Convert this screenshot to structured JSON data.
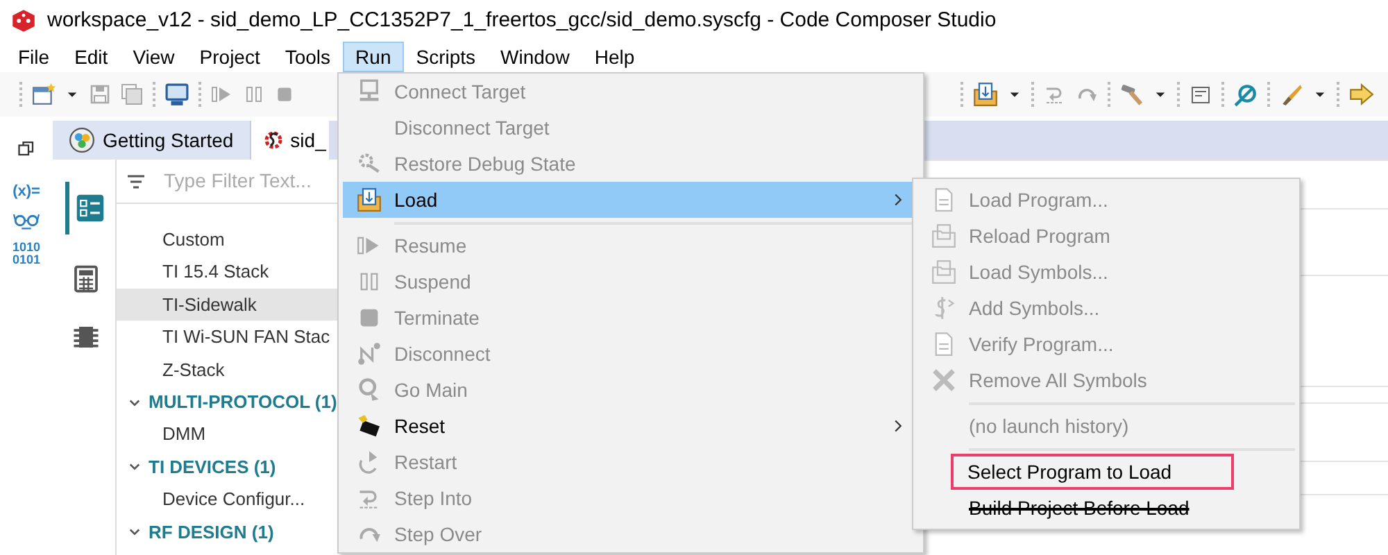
{
  "window": {
    "title": "workspace_v12 - sid_demo_LP_CC1352P7_1_freertos_gcc/sid_demo.syscfg - Code Composer Studio"
  },
  "menubar": [
    {
      "label": "File",
      "selected": false
    },
    {
      "label": "Edit",
      "selected": false
    },
    {
      "label": "View",
      "selected": false
    },
    {
      "label": "Project",
      "selected": false
    },
    {
      "label": "Tools",
      "selected": false
    },
    {
      "label": "Run",
      "selected": true
    },
    {
      "label": "Scripts",
      "selected": false
    },
    {
      "label": "Window",
      "selected": false
    },
    {
      "label": "Help",
      "selected": false
    }
  ],
  "left_rail": {
    "variables_label": "(x)=",
    "binary_lines": [
      "1010",
      "0101"
    ]
  },
  "editor_tabs": [
    {
      "label": "Getting Started",
      "selected": false
    },
    {
      "label": "sid_",
      "selected": true
    }
  ],
  "filter": {
    "placeholder": "Type Filter Text..."
  },
  "tree": [
    {
      "kind": "item",
      "label": "Custom",
      "selected": false
    },
    {
      "kind": "item",
      "label": "TI 15.4 Stack",
      "selected": false
    },
    {
      "kind": "item",
      "label": "TI-Sidewalk",
      "selected": true
    },
    {
      "kind": "item",
      "label": "TI Wi-SUN FAN Stac",
      "selected": false
    },
    {
      "kind": "item",
      "label": "Z-Stack",
      "selected": false
    },
    {
      "kind": "group",
      "label": "MULTI-PROTOCOL (1)",
      "expanded": true,
      "children": [
        {
          "label": "DMM",
          "selected": false
        }
      ]
    },
    {
      "kind": "group",
      "label": "TI DEVICES (1)",
      "expanded": true,
      "children": [
        {
          "label": "Device Configur...",
          "selected": false
        }
      ]
    },
    {
      "kind": "group",
      "label": "RF DESIGN (1)",
      "expanded": true
    }
  ],
  "run_menu": [
    {
      "kind": "item",
      "label": "Connect Target",
      "disabled": true,
      "selected": false,
      "has_submenu": false
    },
    {
      "kind": "item",
      "label": "Disconnect Target",
      "disabled": true,
      "selected": false,
      "has_submenu": false
    },
    {
      "kind": "item",
      "label": "Restore Debug State",
      "disabled": true,
      "selected": false,
      "has_submenu": false
    },
    {
      "kind": "item",
      "label": "Load",
      "disabled": false,
      "selected": true,
      "has_submenu": true
    },
    {
      "kind": "separator"
    },
    {
      "kind": "item",
      "label": "Resume",
      "disabled": true,
      "selected": false,
      "has_submenu": false
    },
    {
      "kind": "item",
      "label": "Suspend",
      "disabled": true,
      "selected": false,
      "has_submenu": false
    },
    {
      "kind": "item",
      "label": "Terminate",
      "disabled": true,
      "selected": false,
      "has_submenu": false
    },
    {
      "kind": "item",
      "label": "Disconnect",
      "disabled": true,
      "selected": false,
      "has_submenu": false
    },
    {
      "kind": "item",
      "label": "Go Main",
      "disabled": true,
      "selected": false,
      "has_submenu": false
    },
    {
      "kind": "item",
      "label": "Reset",
      "disabled": false,
      "selected": false,
      "has_submenu": true
    },
    {
      "kind": "item",
      "label": "Restart",
      "disabled": true,
      "selected": false,
      "has_submenu": false
    },
    {
      "kind": "item",
      "label": "Step Into",
      "disabled": true,
      "selected": false,
      "has_submenu": false
    },
    {
      "kind": "item",
      "label": "Step Over",
      "disabled": true,
      "selected": false,
      "has_submenu": false
    }
  ],
  "load_submenu": [
    {
      "kind": "item",
      "label": "Load Program...",
      "disabled": true,
      "highlighted": false,
      "struck": false
    },
    {
      "kind": "item",
      "label": "Reload Program",
      "disabled": true,
      "highlighted": false,
      "struck": false
    },
    {
      "kind": "item",
      "label": "Load Symbols...",
      "disabled": true,
      "highlighted": false,
      "struck": false
    },
    {
      "kind": "item",
      "label": "Add Symbols...",
      "disabled": true,
      "highlighted": false,
      "struck": false
    },
    {
      "kind": "item",
      "label": "Verify Program...",
      "disabled": true,
      "highlighted": false,
      "struck": false
    },
    {
      "kind": "item",
      "label": "Remove All Symbols",
      "disabled": true,
      "highlighted": false,
      "struck": false
    },
    {
      "kind": "separator"
    },
    {
      "kind": "item",
      "label": "(no launch history)",
      "disabled": true,
      "highlighted": false,
      "struck": false
    },
    {
      "kind": "separator"
    },
    {
      "kind": "item",
      "label": "Select Program to Load",
      "disabled": false,
      "highlighted": true,
      "struck": false
    },
    {
      "kind": "item",
      "label": "Build Project Before Load",
      "disabled": false,
      "highlighted": false,
      "struck": true
    }
  ]
}
